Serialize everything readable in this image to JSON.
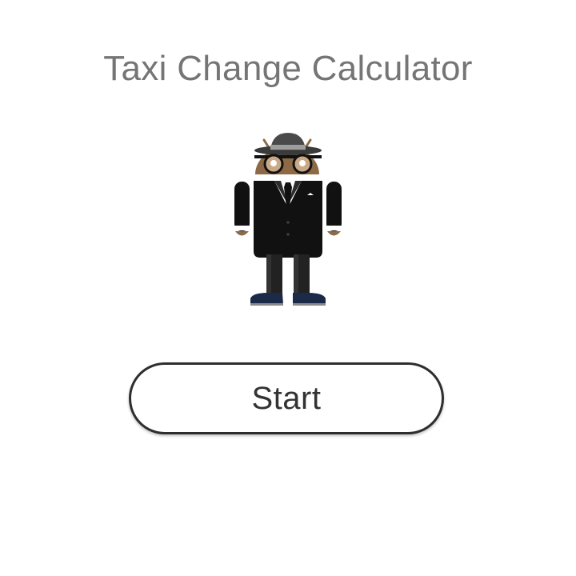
{
  "app": {
    "title": "Taxi Change Calculator"
  },
  "illustration": {
    "icon": "android-gangster-mascot-icon"
  },
  "actions": {
    "start_label": "Start"
  },
  "colors": {
    "title_text": "#757575",
    "button_border": "#2e2e2e",
    "button_text": "#333333",
    "background": "#ffffff"
  }
}
